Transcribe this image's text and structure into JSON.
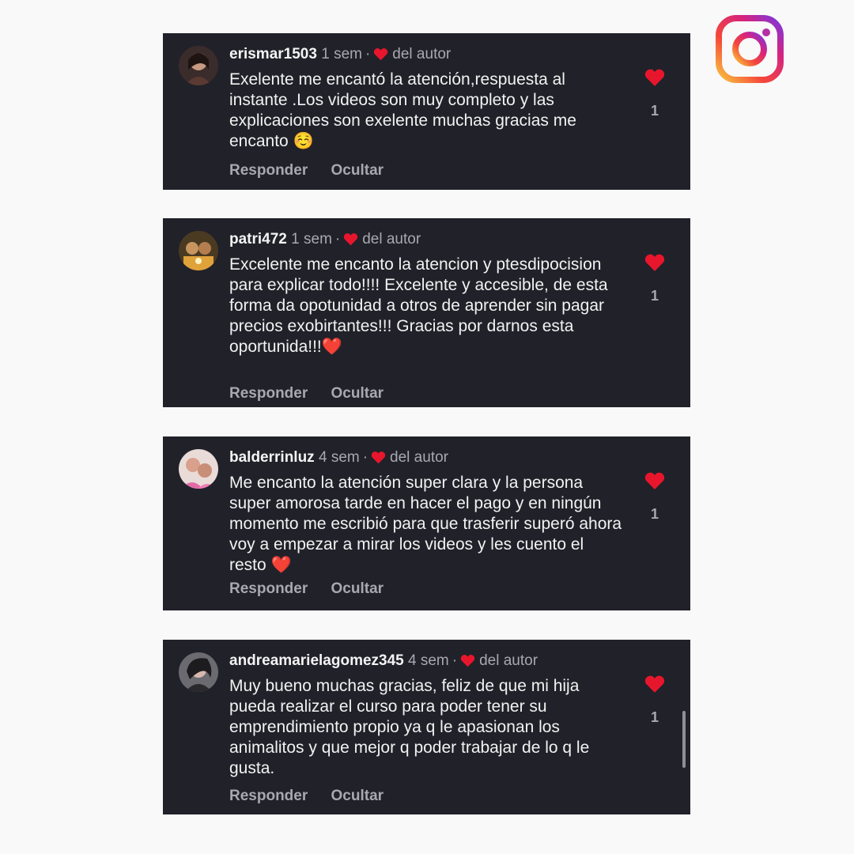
{
  "brand": {
    "logo_icon": "instagram-logo-icon"
  },
  "colors": {
    "card_bg": "#21212a",
    "heart": "#e8162c",
    "meta_text": "#a8a8b0"
  },
  "comments": [
    {
      "username": "erismar1503",
      "time": "1 sem",
      "separator": "·",
      "author_like_label": "del autor",
      "text": "Exelente me encantó la atención,respuesta al instante .Los videos son muy completo y las explicaciones son exelente muchas gracias me encanto ☺️",
      "like_count": "1",
      "reply_label": "Responder",
      "hide_label": "Ocultar"
    },
    {
      "username": "patri472",
      "time": "1 sem",
      "separator": "·",
      "author_like_label": "del autor",
      "text": "Excelente me encanto la atencion y ptesdipocision para explicar todo!!!! Excelente y accesible, de esta forma da opotunidad a otros de aprender sin pagar precios exobirtantes!!! Gracias por darnos esta oportunida!!!❤️",
      "like_count": "1",
      "reply_label": "Responder",
      "hide_label": "Ocultar"
    },
    {
      "username": "balderrinluz",
      "time": "4 sem",
      "separator": "·",
      "author_like_label": "del autor",
      "text": "Me encanto  la atención super clara y la persona super amorosa tarde en hacer el pago y en ningún momento  me escribió para que trasferir  superó ahora voy a empezar a mirar los videos y les cuento el resto ❤️",
      "like_count": "1",
      "reply_label": "Responder",
      "hide_label": "Ocultar"
    },
    {
      "username": "andreamarielagomez345",
      "time": "4 sem",
      "separator": "·",
      "author_like_label": "del autor",
      "text": "Muy bueno muchas gracias, feliz de que mi hija pueda realizar el curso para poder tener su emprendimiento propio ya q le apasionan los animalitos y que mejor q poder trabajar de lo q le gusta.",
      "like_count": "1",
      "reply_label": "Responder",
      "hide_label": "Ocultar"
    }
  ]
}
